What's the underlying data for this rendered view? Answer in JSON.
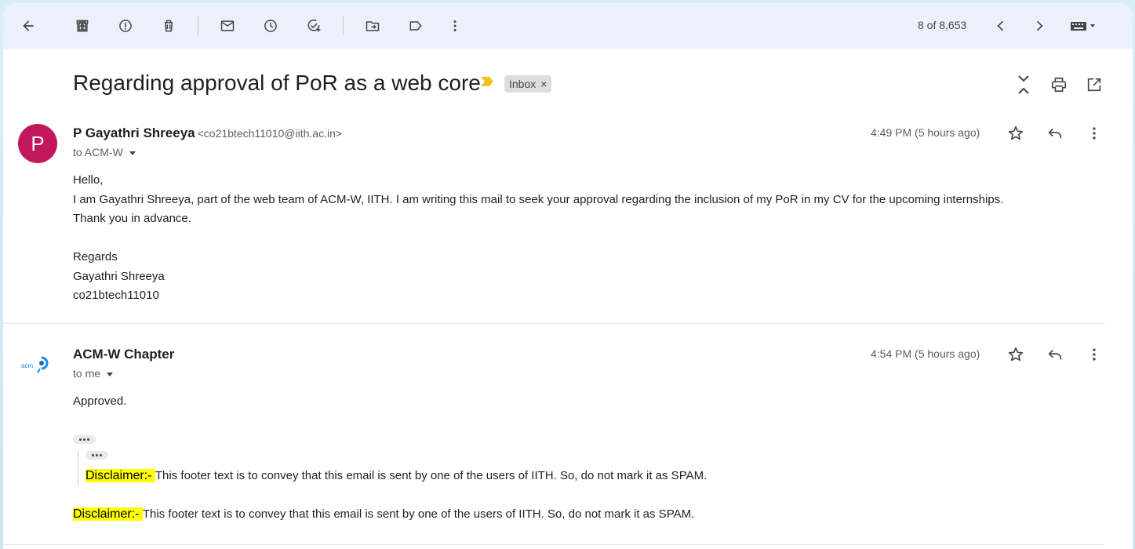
{
  "toolbar": {
    "count": "8 of 8,653",
    "icons": [
      "back-arrow-icon",
      "archive-icon",
      "report-spam-icon",
      "delete-icon",
      "mark-unread-icon",
      "snooze-icon",
      "add-task-icon",
      "move-to-icon",
      "label-icon",
      "more-vert-icon",
      "chevron-left-icon",
      "chevron-right-icon",
      "keyboard-icon"
    ]
  },
  "thread": {
    "subject": "Regarding approval of PoR as a web core",
    "label_chip": "Inbox",
    "label_remove": "×"
  },
  "messages": [
    {
      "avatar_letter": "P",
      "avatar_color": "#c2185b",
      "sender_name": "P Gayathri Shreeya",
      "sender_email": "<co21btech11010@iith.ac.in>",
      "to": "to ACM-W",
      "time": "4:49 PM (5 hours ago)",
      "body_lines": [
        "Hello,",
        "I am Gayathri Shreeya, part of the web team of ACM-W, IITH. I am writing this mail to seek your approval regarding the inclusion of my PoR in my CV for the upcoming internships.",
        "Thank you in advance.",
        "",
        "Regards",
        "Gayathri Shreeya",
        "co21btech11010"
      ]
    },
    {
      "avatar_logo": "acm-w",
      "sender_name": "ACM-W Chapter",
      "to": "to me",
      "time": "4:54 PM (5 hours ago)",
      "body_lines": [
        "Approved."
      ],
      "quoted_disclaimer_label": "Disclaimer:- ",
      "quoted_disclaimer_text": "This footer text is to convey that this email is sent by one of the users of IITH. So, do not mark it as SPAM.",
      "disclaimer_label": "Disclaimer:- ",
      "disclaimer_text": "This footer text is to convey that this email is sent by one of the users of IITH. So, do not mark it as SPAM."
    }
  ],
  "colors": {
    "highlight": "#ffff00",
    "toolbar_bg": "#eaf1fb",
    "importance": "#f6bf26"
  }
}
